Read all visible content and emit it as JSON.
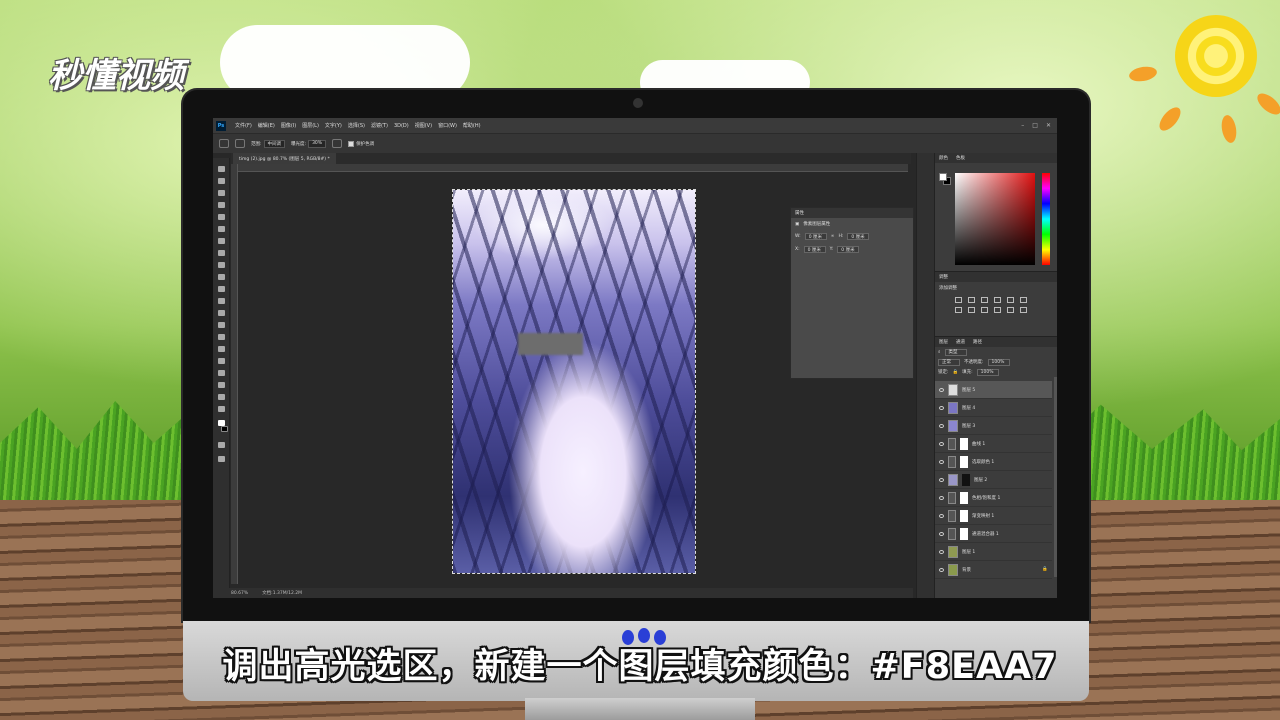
{
  "watermark": {
    "logo_text": "秒懂视频"
  },
  "caption": "调出高光选区，新建一个图层填充颜色：#F8EAA7",
  "photoshop": {
    "menu": [
      "文件(F)",
      "编辑(E)",
      "图像(I)",
      "图层(L)",
      "文字(Y)",
      "选择(S)",
      "滤镜(T)",
      "3D(D)",
      "视图(V)",
      "窗口(W)",
      "帮助(H)"
    ],
    "options": {
      "range_label": "范围:",
      "range_value": "中间调",
      "exposure_label": "曝光度:",
      "exposure_value": "30%",
      "protect_label": "保护色调"
    },
    "doc_tab": "timg (2).jpg @ 80.7% (图层 5, RGB/8#) *",
    "status": {
      "zoom": "80.67%",
      "doc": "文档:1.37M/12.2M"
    },
    "properties": {
      "title": "属性",
      "subtitle": "像素图层属性",
      "w_label": "W:",
      "w_value": "0 厘米",
      "h_label": "H:",
      "h_value": "0 厘米",
      "x_label": "X:",
      "x_value": "0 厘米",
      "y_label": "Y:",
      "y_value": "0 厘米"
    },
    "color_panel": {
      "tabs": [
        "颜色",
        "色板"
      ]
    },
    "adjust_panel": {
      "title": "调整",
      "subtitle": "添加调整"
    },
    "layers_panel": {
      "tabs": [
        "图层",
        "通道",
        "路径"
      ],
      "filter": "类型",
      "blend": "正常",
      "opacity_label": "不透明度:",
      "opacity": "100%",
      "lock_label": "锁定:",
      "fill_label": "填充:",
      "fill": "100%",
      "layers": [
        "图层 5",
        "图层 4",
        "图层 3",
        "曲线 1",
        "选取颜色 1",
        "图层 2",
        "色相/饱和度 1",
        "渐变映射 1",
        "通道混合器 1",
        "图层 1",
        "背景"
      ]
    }
  }
}
